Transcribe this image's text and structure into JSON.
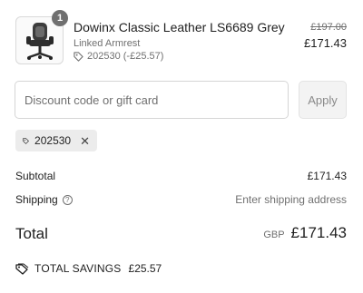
{
  "product": {
    "image_icon": "gaming-chair-image",
    "quantity": "1",
    "name": "Dowinx Classic Leather LS6689 Grey",
    "variant": "Linked Armrest",
    "discount_text": "202530 (-£25.57)",
    "original_price": "£197.00",
    "price": "£171.43"
  },
  "discount": {
    "placeholder": "Discount code or gift card",
    "apply_label": "Apply",
    "applied_code": "202530"
  },
  "summary": {
    "subtotal_label": "Subtotal",
    "subtotal_value": "£171.43",
    "shipping_label": "Shipping",
    "shipping_value": "Enter shipping address",
    "total_label": "Total",
    "currency": "GBP",
    "total_value": "£171.43",
    "savings_label": "TOTAL SAVINGS",
    "savings_value": "£25.57"
  },
  "colors": {
    "text": "#1f1f1f",
    "muted": "#707070",
    "chip_bg": "#ececec",
    "button_bg": "#f3f3f3"
  }
}
